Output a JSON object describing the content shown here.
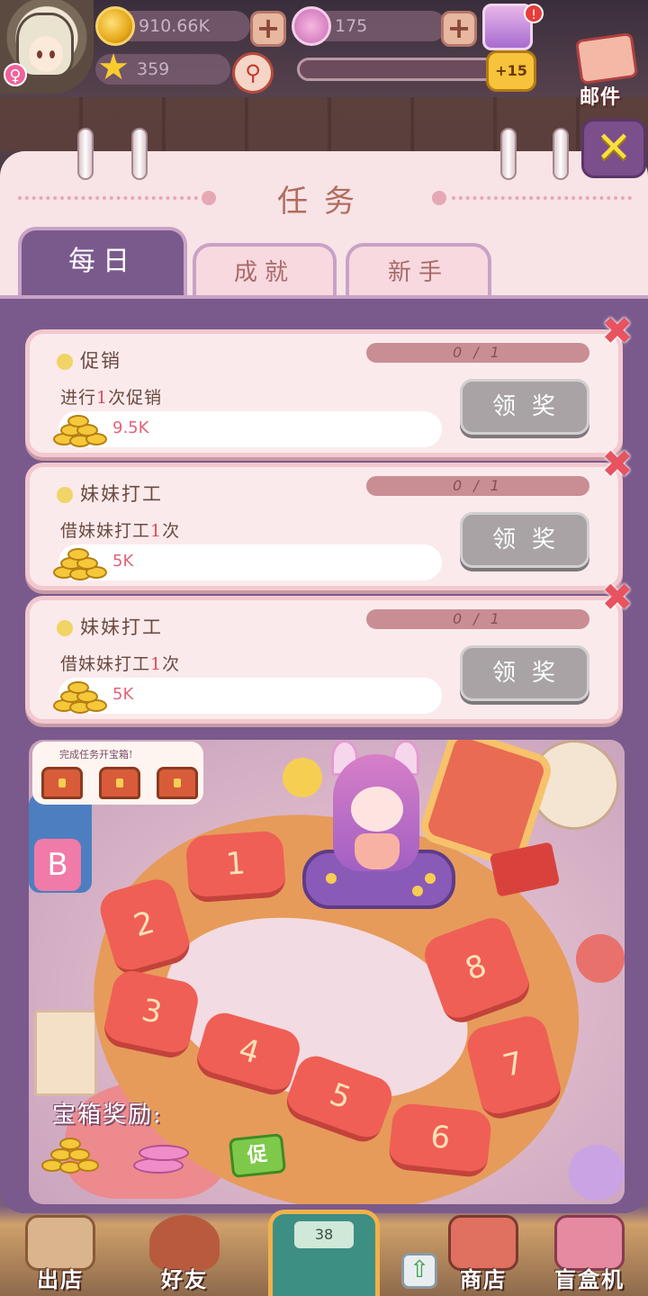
{
  "hud": {
    "coins": "910.66K",
    "crowns": "175",
    "stars": "359",
    "level_bonus": "+15",
    "notification_count": "!",
    "mail_label": "邮件",
    "gender_symbol": "♀"
  },
  "panel": {
    "title": "任务",
    "tabs": [
      {
        "label": "每日",
        "active": true
      },
      {
        "label": "成就",
        "active": false
      },
      {
        "label": "新手",
        "active": false
      }
    ]
  },
  "tasks": [
    {
      "name": "促销",
      "desc_prefix": "进行",
      "desc_count": "1",
      "desc_suffix": "次促销",
      "progress": "0 / 1",
      "reward": "9.5K",
      "claim_label": "领奖"
    },
    {
      "name": "妹妹打工",
      "desc_prefix": "借妹妹打工",
      "desc_count": "1",
      "desc_suffix": "次",
      "progress": "0 / 1",
      "reward": "5K",
      "claim_label": "领奖"
    },
    {
      "name": "妹妹打工",
      "desc_prefix": "借妹妹打工",
      "desc_count": "1",
      "desc_suffix": "次",
      "progress": "0 / 1",
      "reward": "5K",
      "claim_label": "领奖"
    }
  ],
  "board": {
    "chest_hint": "完成任务开宝箱!",
    "reward_label": "宝箱奖励:",
    "promo_label": "促",
    "tiles": [
      "1",
      "2",
      "3",
      "4",
      "5",
      "6",
      "7",
      "8"
    ]
  },
  "nav": {
    "items": [
      "出店",
      "好友",
      "商店",
      "盲盒机"
    ],
    "center_value": "38"
  },
  "colors": {
    "panel_purple": "#7a5a8c",
    "card_pink": "#fbeaec",
    "tile_red": "#ef5f55",
    "highlight_red": "#e54a5a",
    "close_yellow": "#f8df3c"
  }
}
